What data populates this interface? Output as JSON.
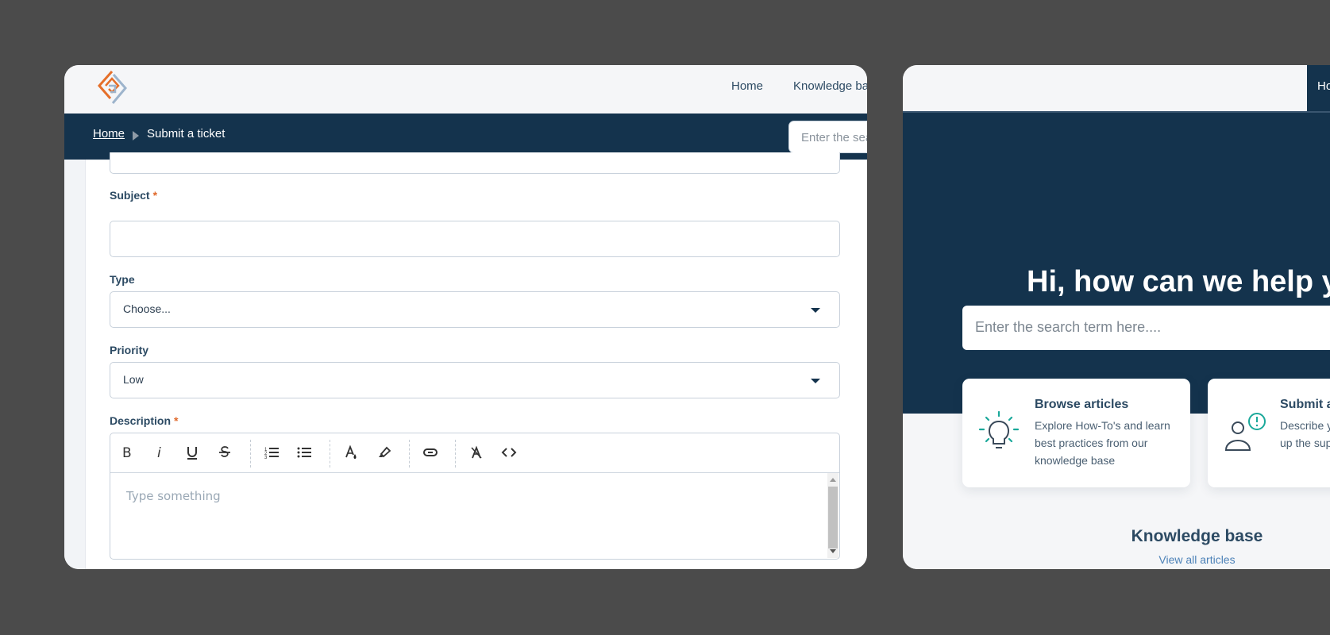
{
  "left_window": {
    "header": {
      "nav": [
        "Home",
        "Knowledge base"
      ]
    },
    "breadcrumb": {
      "home": "Home",
      "current": "Submit a ticket"
    },
    "band_search": {
      "placeholder": "Enter the search term here...."
    },
    "form": {
      "subject": {
        "label": "Subject",
        "required_mark": "*",
        "value": ""
      },
      "type": {
        "label": "Type",
        "value": "Choose..."
      },
      "priority": {
        "label": "Priority",
        "value": "Low"
      },
      "description": {
        "label": "Description",
        "required_mark": "*",
        "placeholder": "Type something",
        "toolbar": [
          "bold",
          "italic",
          "underline",
          "strikethrough",
          "ordered-list",
          "bullet-list",
          "text-color",
          "highlight",
          "link",
          "clear-format",
          "code"
        ]
      }
    }
  },
  "right_window": {
    "nav": [
      "Home"
    ],
    "hero": {
      "title": "Hi, how can we help you?",
      "search_placeholder": "Enter the search term here...."
    },
    "tiles": [
      {
        "title": "Browse articles",
        "description": "Explore How-To's and learn best practices from our knowledge base"
      },
      {
        "title": "Submit a ticket",
        "description": "Describe your issue and fill up the support form"
      }
    ],
    "knowledge_base": {
      "title": "Knowledge base",
      "link": "View all articles"
    }
  },
  "colors": {
    "navy": "#14334d",
    "accent_orange": "#e06a2c",
    "teal": "#1aa89a",
    "link_blue": "#4d82b8"
  }
}
